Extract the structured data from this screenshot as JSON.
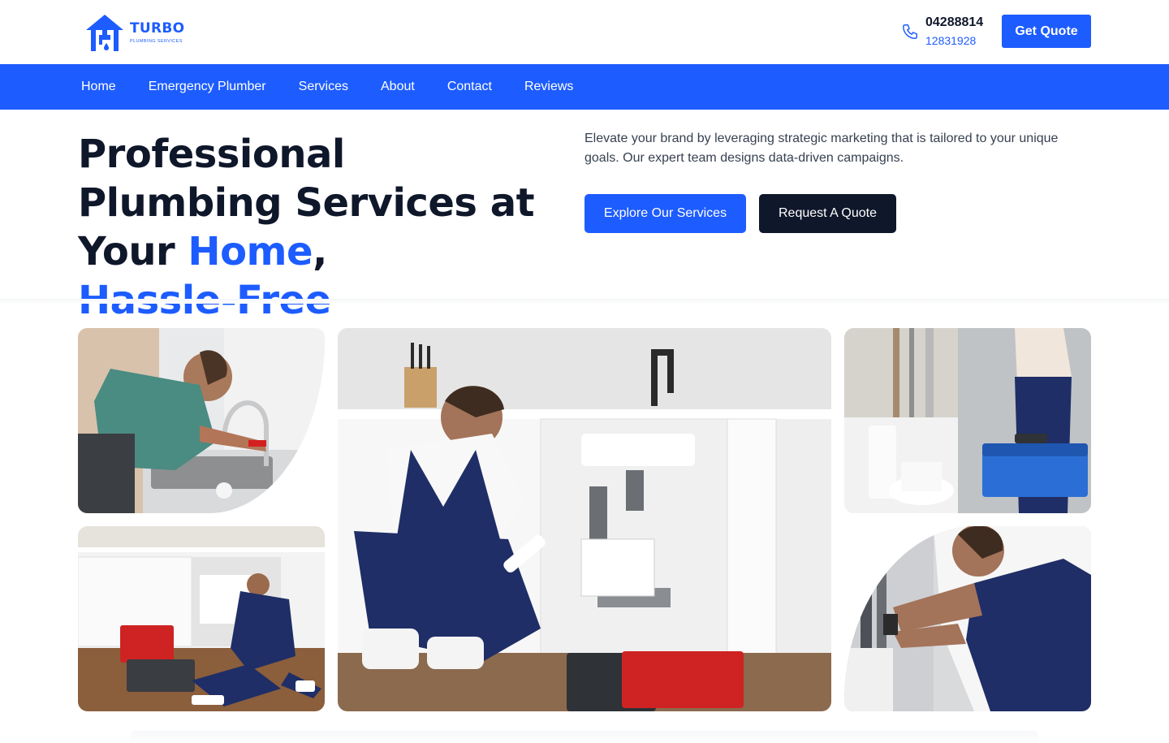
{
  "brand": {
    "name": "TURBO",
    "tagline": "PLUMBING SERVICES",
    "color": "#1d5cff"
  },
  "contact": {
    "phone_main": "04288814",
    "phone_alt": "12831928",
    "icon": "phone-icon"
  },
  "header": {
    "cta_label": "Get Quote"
  },
  "nav": {
    "items": [
      "Home",
      "Emergency Plumber",
      "Services",
      "About",
      "Contact",
      "Reviews"
    ]
  },
  "hero": {
    "title_part1": "Professional Plumbing Services at Your ",
    "title_accent1": "Home",
    "title_part2": ",",
    "title_accent2": "Hassle-Free",
    "description": "Elevate your brand by leveraging strategic marketing that is tailored to your unique goals. Our expert team designs data-driven campaigns.",
    "primary_button": "Explore Our Services",
    "secondary_button": "Request A Quote"
  },
  "gallery": {
    "images": [
      "plumber-fixing-kitchen-faucet",
      "plumber-sitting-on-floor-under-sink",
      "plumber-installing-sink-pipes",
      "plumber-carrying-toolbox-bathroom",
      "plumber-working-under-sink"
    ]
  },
  "colors": {
    "accent": "#1d5cff",
    "dark": "#0f172a"
  }
}
